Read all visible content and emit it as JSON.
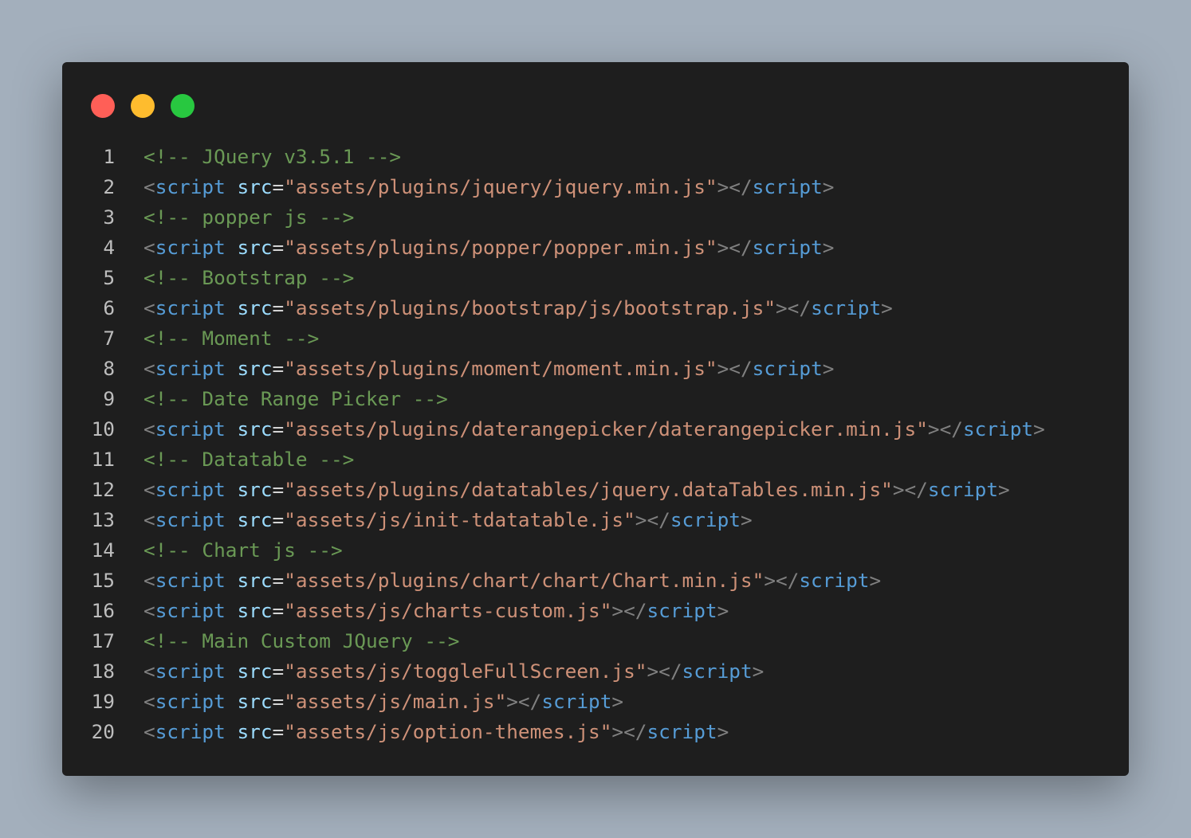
{
  "window": {
    "controls": [
      {
        "name": "close",
        "color": "#ff5f57"
      },
      {
        "name": "minimize",
        "color": "#febc2e"
      },
      {
        "name": "maximize",
        "color": "#28c840"
      }
    ]
  },
  "code": {
    "lines": [
      {
        "num": "1",
        "type": "comment",
        "text": "<!-- JQuery v3.5.1 -->"
      },
      {
        "num": "2",
        "type": "script",
        "src": "assets/plugins/jquery/jquery.min.js"
      },
      {
        "num": "3",
        "type": "comment",
        "text": "<!-- popper js -->"
      },
      {
        "num": "4",
        "type": "script",
        "src": "assets/plugins/popper/popper.min.js"
      },
      {
        "num": "5",
        "type": "comment",
        "text": "<!-- Bootstrap -->"
      },
      {
        "num": "6",
        "type": "script",
        "src": "assets/plugins/bootstrap/js/bootstrap.js"
      },
      {
        "num": "7",
        "type": "comment",
        "text": "<!-- Moment -->"
      },
      {
        "num": "8",
        "type": "script",
        "src": "assets/plugins/moment/moment.min.js"
      },
      {
        "num": "9",
        "type": "comment",
        "text": "<!-- Date Range Picker -->"
      },
      {
        "num": "10",
        "type": "script",
        "src": "assets/plugins/daterangepicker/daterangepicker.min.js"
      },
      {
        "num": "11",
        "type": "comment",
        "text": "<!-- Datatable -->"
      },
      {
        "num": "12",
        "type": "script",
        "src": "assets/plugins/datatables/jquery.dataTables.min.js"
      },
      {
        "num": "13",
        "type": "script",
        "src": "assets/js/init-tdatatable.js"
      },
      {
        "num": "14",
        "type": "comment",
        "text": "<!-- Chart js -->"
      },
      {
        "num": "15",
        "type": "script",
        "src": "assets/plugins/chart/chart/Chart.min.js"
      },
      {
        "num": "16",
        "type": "script",
        "src": "assets/js/charts-custom.js"
      },
      {
        "num": "17",
        "type": "comment",
        "text": "<!-- Main Custom JQuery -->"
      },
      {
        "num": "18",
        "type": "script",
        "src": "assets/js/toggleFullScreen.js"
      },
      {
        "num": "19",
        "type": "script",
        "src": "assets/js/main.js"
      },
      {
        "num": "20",
        "type": "script",
        "src": "assets/js/option-themes.js"
      }
    ],
    "tokens": {
      "open_lt": "<",
      "tag": "script",
      "attr": "src",
      "eq": "=",
      "quote": "\"",
      "gt_close_lt": "></",
      "gt": ">",
      "space": " "
    }
  },
  "colors": {
    "background": "#a3afbc",
    "editor": "#1e1e1e",
    "comment": "#6a9955",
    "tag": "#569cd6",
    "attribute": "#9cdcfe",
    "string": "#ce9178",
    "punctuation": "#808080",
    "line_number": "#bdbdbd"
  }
}
